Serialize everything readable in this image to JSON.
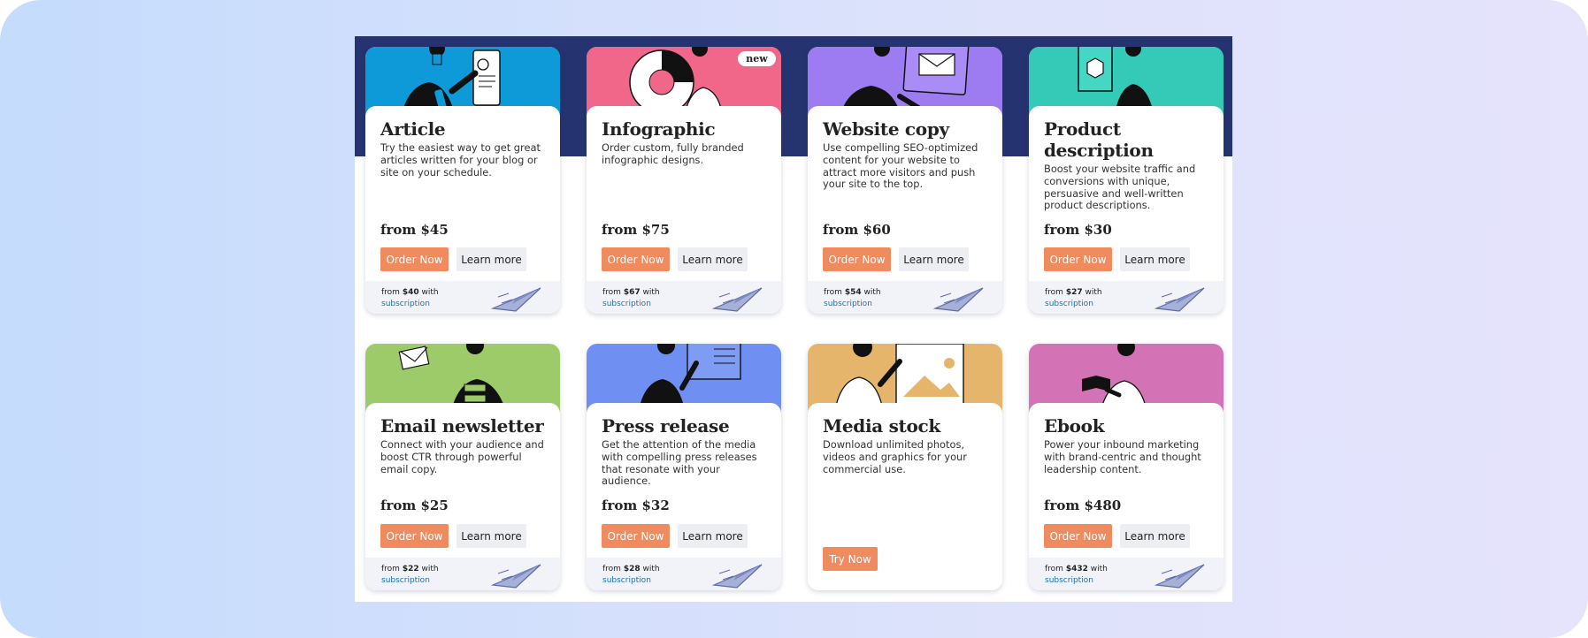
{
  "colors": {
    "accent": "#f08a5f",
    "band": "#253470",
    "link": "#1a6fb5"
  },
  "cards": [
    {
      "title": "Article",
      "desc": "Try the easiest way to get great articles written for your blog or site on your schedule.",
      "price": "from $45",
      "order": "Order Now",
      "learn": "Learn more",
      "sub_from": "from ",
      "sub_price": "$40",
      "sub_with": " with",
      "sub_link": "subscription",
      "color": "#0e9ad8"
    },
    {
      "title": "Infographic",
      "desc": "Order custom, fully branded infographic designs.",
      "price": "from $75",
      "order": "Order Now",
      "learn": "Learn more",
      "sub_from": "from ",
      "sub_price": "$67",
      "sub_with": " with",
      "sub_link": "subscription",
      "badge": "new",
      "color": "#f0678a"
    },
    {
      "title": "Website copy",
      "desc": "Use compelling SEO-optimized content for your website to attract more visitors and push your site to the top.",
      "price": "from $60",
      "order": "Order Now",
      "learn": "Learn more",
      "sub_from": "from ",
      "sub_price": "$54",
      "sub_with": " with",
      "sub_link": "subscription",
      "color": "#9d7cf2"
    },
    {
      "title": "Product description",
      "desc": "Boost your website traffic and conversions with unique, persuasive and well-written product descriptions.",
      "price": "from $30",
      "order": "Order Now",
      "learn": "Learn more",
      "sub_from": "from ",
      "sub_price": "$27",
      "sub_with": " with",
      "sub_link": "subscription",
      "color": "#35c9b8"
    },
    {
      "title": "Email newsletter",
      "desc": "Connect with your audience and boost CTR through powerful email copy.",
      "price": "from $25",
      "order": "Order Now",
      "learn": "Learn more",
      "sub_from": "from ",
      "sub_price": "$22",
      "sub_with": " with",
      "sub_link": "subscription",
      "color": "#9ecb6a"
    },
    {
      "title": "Press release",
      "desc": "Get the attention of the media with compelling press releases that resonate with your audience.",
      "price": "from $32",
      "order": "Order Now",
      "learn": "Learn more",
      "sub_from": "from ",
      "sub_price": "$28",
      "sub_with": " with",
      "sub_link": "subscription",
      "color": "#6f8ff3"
    },
    {
      "title": "Media stock",
      "desc": "Download unlimited photos, videos and graphics for your commercial use.",
      "try": "Try Now",
      "color": "#e6b56c"
    },
    {
      "title": "Ebook",
      "desc": "Power your inbound marketing with brand-centric and thought leadership content.",
      "price": "from $480",
      "order": "Order Now",
      "learn": "Learn more",
      "sub_from": "from ",
      "sub_price": "$432",
      "sub_with": " with",
      "sub_link": "subscription",
      "color": "#d372b4"
    }
  ]
}
